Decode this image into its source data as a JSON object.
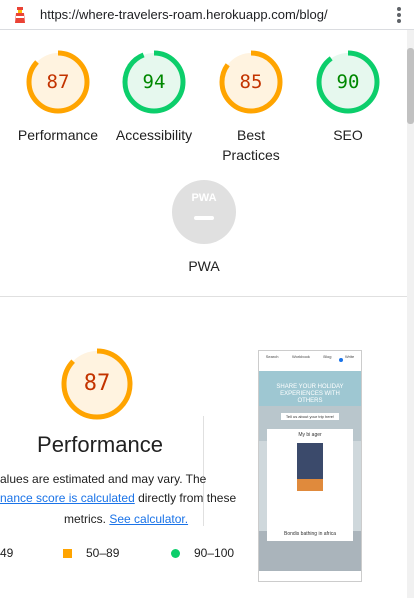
{
  "browser": {
    "url": "https://where-travelers-roam.herokuapp.com/blog/"
  },
  "categories": [
    {
      "score": "87",
      "label": "Performance",
      "status": "average"
    },
    {
      "score": "94",
      "label": "Accessibility",
      "status": "pass"
    },
    {
      "score": "85",
      "label": "Best Practices",
      "label_line1": "Best",
      "label_line2": "Practices",
      "status": "average"
    },
    {
      "score": "90",
      "label": "SEO",
      "status": "pass"
    }
  ],
  "pwa": {
    "badge": "PWA",
    "label": "PWA"
  },
  "performance": {
    "score": "87",
    "title": "Performance",
    "line1": "alues are estimated and may vary. The",
    "line2_link": "nance score is calculated",
    "line2_rest": " directly from these",
    "line3_pre": "metrics. ",
    "line3_link": "See calculator."
  },
  "legend": [
    {
      "range": "49"
    },
    {
      "range": "50–89"
    },
    {
      "range": "90–100"
    }
  ],
  "screenshot": {
    "heading": "SHARE YOUR HOLIDAY EXPERIENCES WITH OTHERS",
    "button": "Tell us about your trip here!",
    "card_title": "My bi ager",
    "card_caption": "Bondis bathing in africa",
    "nav": [
      "Search",
      "Workbook",
      "Blog",
      "Write"
    ]
  },
  "colors": {
    "orange": "#ffa400",
    "orange_text": "#c33300",
    "orange_fill": "#fff3e0",
    "green": "#0cce6b",
    "green_text": "#008800",
    "green_fill": "#e6f8ee",
    "pwa_gray": "#e0e0e0",
    "link": "#1a73e8"
  }
}
